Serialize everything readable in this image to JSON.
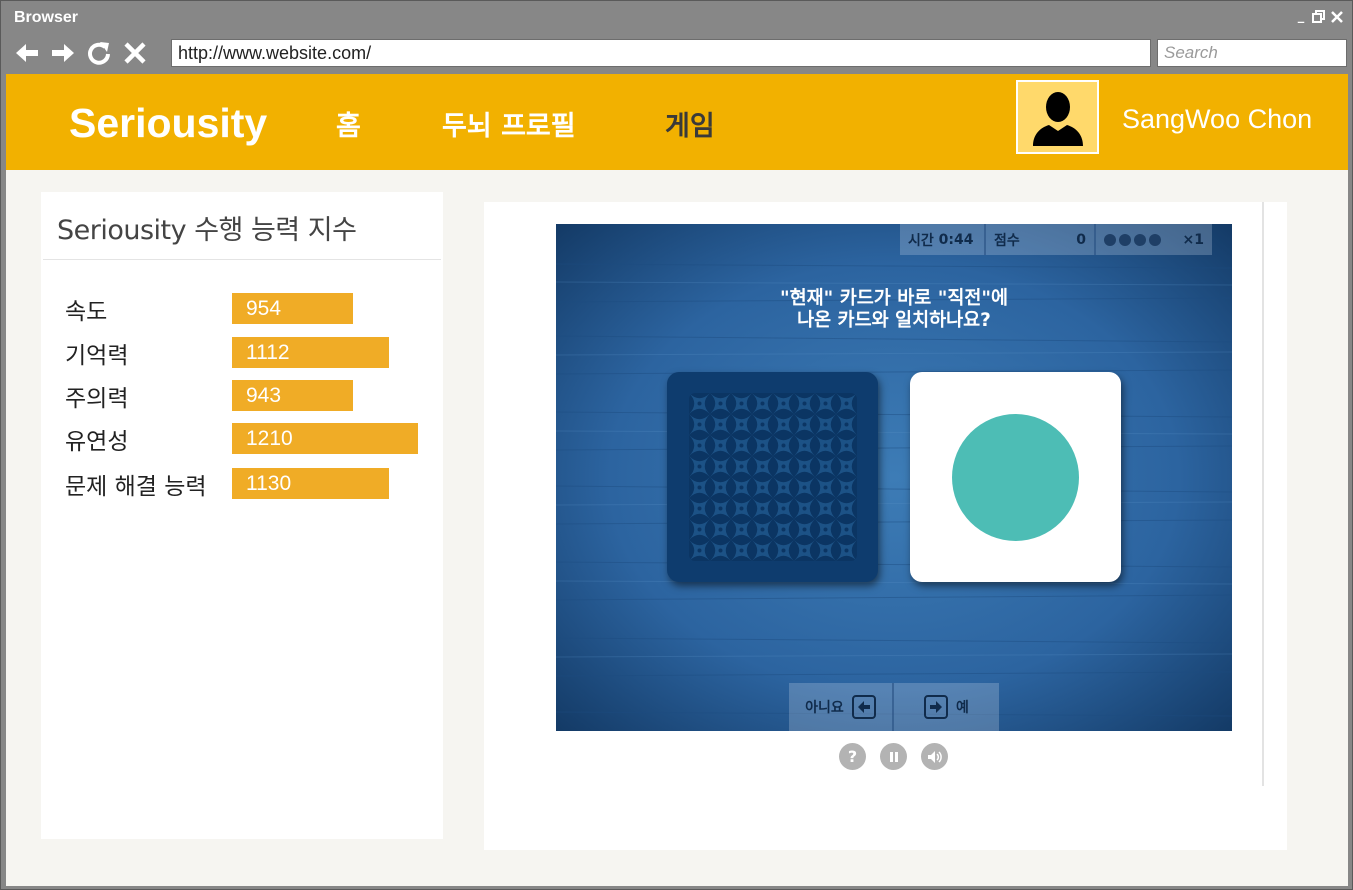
{
  "browser": {
    "title": "Browser",
    "url": "http://www.website.com/",
    "search_placeholder": "Search"
  },
  "header": {
    "logo": "Seriousity",
    "nav": [
      "홈",
      "두뇌 프로필",
      "게임"
    ],
    "username": "SangWoo Chon"
  },
  "stats": {
    "title": "Seriousity 수행 능력 지수",
    "items": [
      {
        "label": "속도",
        "value": "954"
      },
      {
        "label": "기억력",
        "value": "1112"
      },
      {
        "label": "주의력",
        "value": "943"
      },
      {
        "label": "유연성",
        "value": "1210"
      },
      {
        "label": "문제 해결 능력",
        "value": "1130"
      }
    ]
  },
  "game": {
    "time_label": "시간",
    "time_value": "0:44",
    "score_label": "점수",
    "score_value": "0",
    "multiplier": "×1",
    "lives": 4,
    "question_line1": "\"현재\" 카드가 바로 \"직전\"에",
    "question_line2": "나온 카드와 일치하나요?",
    "no_label": "아니요",
    "yes_label": "예",
    "circle_color": "#4dbdb5",
    "card_back_color": "#0e3c6e"
  },
  "controls": {
    "help_icon": "?"
  },
  "colors": {
    "header": "#f2b100",
    "bar": "#f0ac26",
    "chrome": "#878787"
  }
}
